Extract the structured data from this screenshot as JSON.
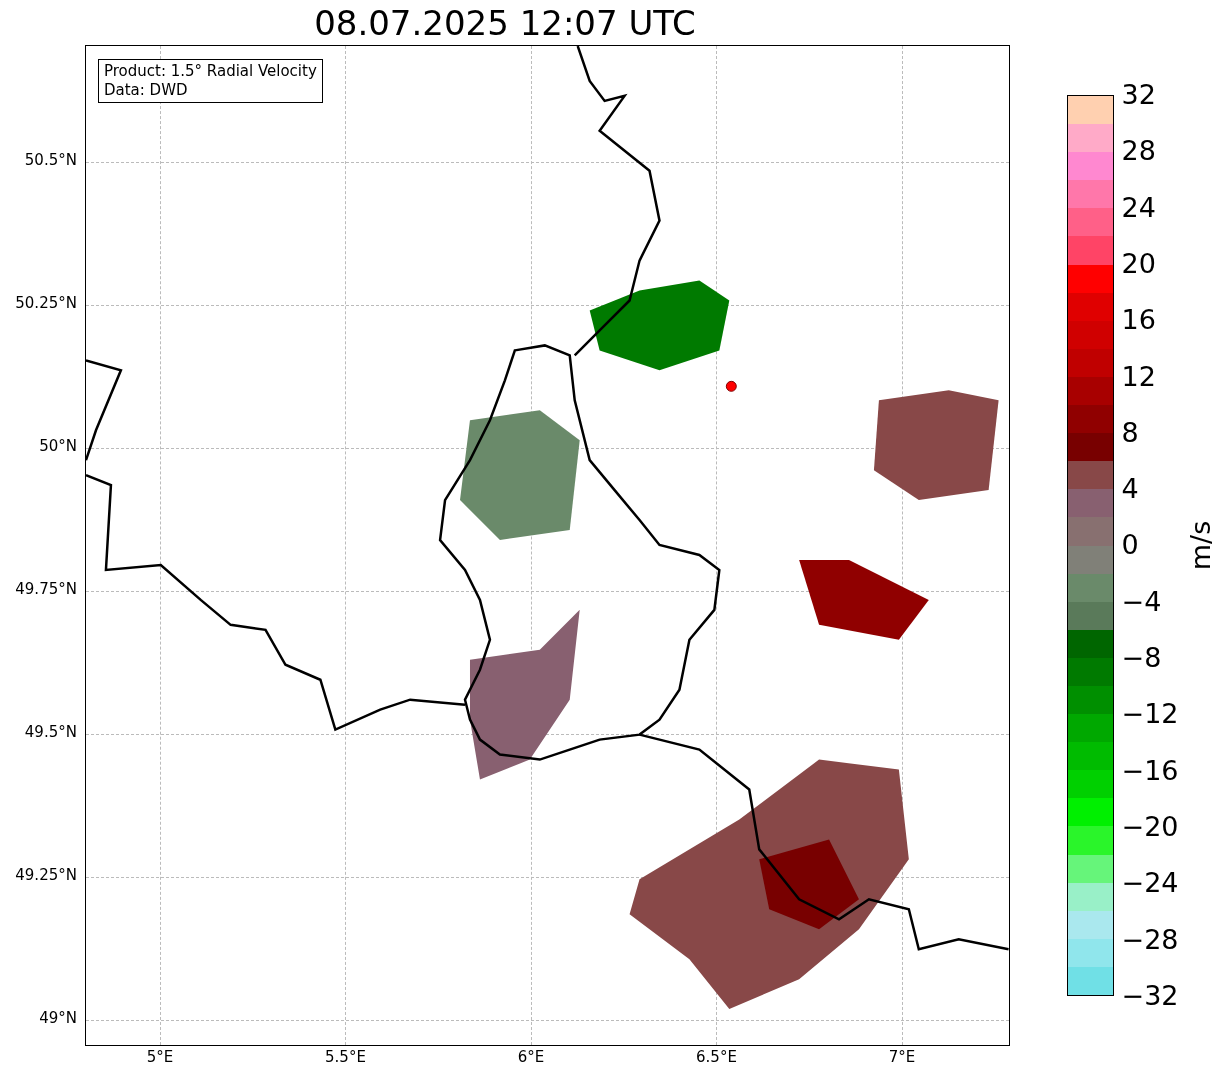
{
  "title": "08.07.2025 12:07 UTC",
  "legend": {
    "lines": [
      "Product: 1.5° Radial Velocity",
      "Data: DWD"
    ]
  },
  "yticks": [
    "50.5°N",
    "50.25°N",
    "50°N",
    "49.75°N",
    "49.5°N",
    "49.25°N",
    "49°N"
  ],
  "xticks": [
    "5°E",
    "5.5°E",
    "6°E",
    "6.5°E",
    "7°E"
  ],
  "colorbar": {
    "label": "m/s",
    "ticks": [
      "32",
      "28",
      "24",
      "20",
      "16",
      "12",
      "8",
      "4",
      "0",
      "−4",
      "−8",
      "−12",
      "−16",
      "−20",
      "−24",
      "−28",
      "−32"
    ],
    "segments": [
      {
        "color": "#ffd0b0"
      },
      {
        "color": "#ffaac8"
      },
      {
        "color": "#ff88d0"
      },
      {
        "color": "#ff77aa"
      },
      {
        "color": "#ff6088"
      },
      {
        "color": "#ff4466"
      },
      {
        "color": "#ff0000"
      },
      {
        "color": "#e00000"
      },
      {
        "color": "#d00000"
      },
      {
        "color": "#c00000"
      },
      {
        "color": "#a80000"
      },
      {
        "color": "#900000"
      },
      {
        "color": "#780000"
      },
      {
        "color": "#884848"
      },
      {
        "color": "#886070"
      },
      {
        "color": "#887070"
      },
      {
        "color": "#808078"
      },
      {
        "color": "#6a8a6a"
      },
      {
        "color": "#5a7a5a"
      },
      {
        "color": "#006600"
      },
      {
        "color": "#007a00"
      },
      {
        "color": "#008f00"
      },
      {
        "color": "#00a800"
      },
      {
        "color": "#00bb00"
      },
      {
        "color": "#00d000"
      },
      {
        "color": "#00f000"
      },
      {
        "color": "#2af52a"
      },
      {
        "color": "#66f57a"
      },
      {
        "color": "#99f0c8"
      },
      {
        "color": "#aae8ee"
      },
      {
        "color": "#90e6ec"
      },
      {
        "color": "#70e0e6"
      }
    ]
  }
}
